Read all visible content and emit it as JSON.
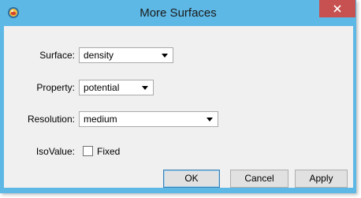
{
  "window": {
    "title": "More Surfaces",
    "app_icon": "java-app-icon",
    "close_icon": "close-icon"
  },
  "form": {
    "surface": {
      "label": "Surface:",
      "value": "density"
    },
    "property": {
      "label": "Property:",
      "value": "potential"
    },
    "resolution": {
      "label": "Resolution:",
      "value": "medium"
    },
    "isovalue": {
      "label": "IsoValue:",
      "checkbox_label": "Fixed",
      "checked": false
    }
  },
  "buttons": {
    "ok": "OK",
    "cancel": "Cancel",
    "apply": "Apply"
  },
  "colors": {
    "titlebar": "#5eb8e5",
    "close_button": "#c75050",
    "dialog_background": "#f0f0f0"
  }
}
